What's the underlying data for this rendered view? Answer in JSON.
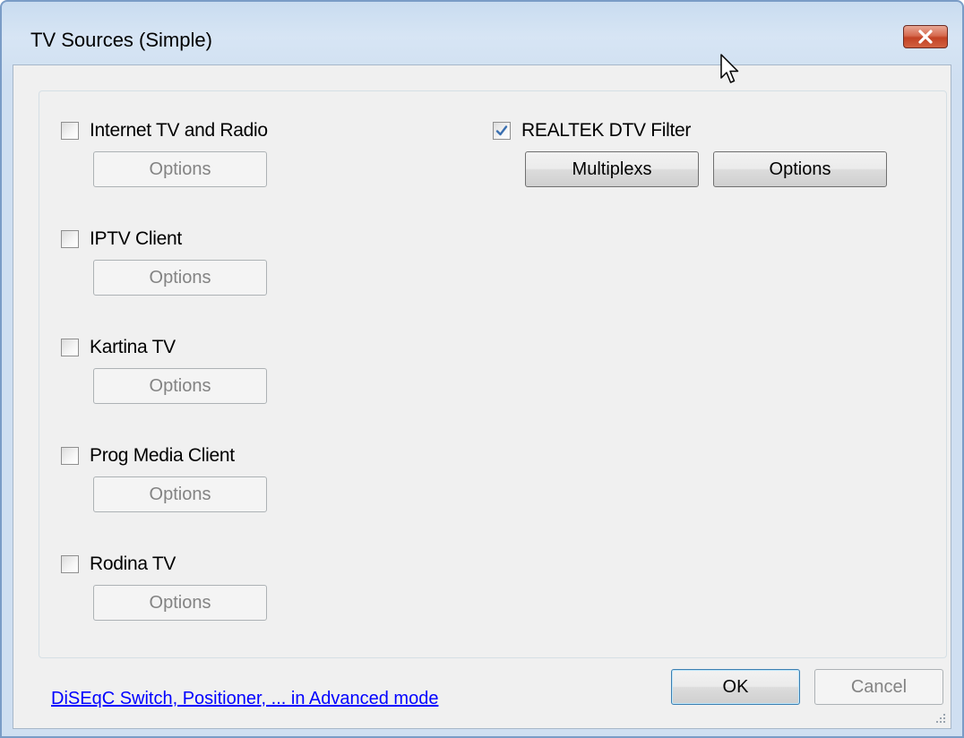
{
  "window": {
    "title": "TV Sources (Simple)",
    "close_icon": "close-icon"
  },
  "sources": [
    {
      "label": "Internet TV and Radio",
      "checked": false,
      "options_label": "Options",
      "enabled": false
    },
    {
      "label": "IPTV Client",
      "checked": false,
      "options_label": "Options",
      "enabled": false
    },
    {
      "label": "Kartina TV",
      "checked": false,
      "options_label": "Options",
      "enabled": false
    },
    {
      "label": "Prog Media Client",
      "checked": false,
      "options_label": "Options",
      "enabled": false
    },
    {
      "label": "Rodina TV",
      "checked": false,
      "options_label": "Options",
      "enabled": false
    }
  ],
  "realtek": {
    "label": "REALTEK DTV Filter",
    "checked": true,
    "multiplexs_label": "Multiplexs",
    "options_label": "Options"
  },
  "footer": {
    "advanced_link": "DiSEqC Switch, Positioner, ... in Advanced mode",
    "ok_label": "OK",
    "cancel_label": "Cancel"
  },
  "colors": {
    "link": "#0000ff",
    "close_button": "#c24225",
    "dialog_background": "#f0f0f0"
  }
}
